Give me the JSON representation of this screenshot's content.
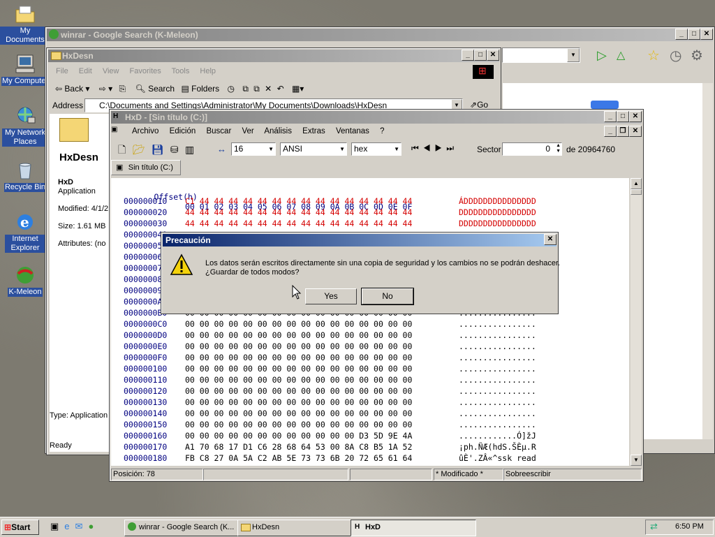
{
  "desktop": {
    "icons": [
      {
        "label": "My Documents",
        "name": "my-documents-icon"
      },
      {
        "label": "My Computer",
        "name": "my-computer-icon"
      },
      {
        "label": "My Network Places",
        "name": "my-network-places-icon"
      },
      {
        "label": "Recycle Bin",
        "name": "recycle-bin-icon"
      },
      {
        "label": "Internet Explorer",
        "name": "internet-explorer-icon"
      },
      {
        "label": "K-Meleon",
        "name": "k-meleon-icon"
      }
    ]
  },
  "browser": {
    "title": "winrar - Google Search (K-Meleon)"
  },
  "explorer": {
    "title": "HxDesn",
    "menu": [
      "File",
      "Edit",
      "View",
      "Favorites",
      "Tools",
      "Help"
    ],
    "toolbar": {
      "back": "Back",
      "search": "Search",
      "folders": "Folders"
    },
    "address_label": "Address",
    "address": "C:\\Documents and Settings\\Administrator\\My Documents\\Downloads\\HxDesn",
    "go": "Go",
    "panel": {
      "title": "HxDesn",
      "file_name": "HxD",
      "file_type": "Application",
      "modified": "Modified: 4/1/2",
      "size": "Size: 1.61 MB",
      "attributes": "Attributes: (no"
    },
    "status_type": "Type: Application",
    "status": "Ready"
  },
  "hxd": {
    "title": "HxD - [Sin título (C:)]",
    "menu": [
      "Archivo",
      "Edición",
      "Buscar",
      "Ver",
      "Análisis",
      "Extras",
      "Ventanas",
      "?"
    ],
    "bytes_per_row": "16",
    "charset": "ANSI",
    "mode": "hex",
    "sector_label": "Sector",
    "sector_value": "0",
    "sector_total": "de 20964760",
    "tab": "Sin título (C:)",
    "header_offset": "Offset(h)",
    "header_cols": "00 01 02 03 04 05 06 07 08 09 0A 0B 0C 0D 0E 0F",
    "rows": [
      {
        "off": "000000010",
        "hex": "C1 44 44 44 44 44 44 44 44 44 44 44 44 44 44 44",
        "asc": "ÁDDDDDDDDDDDDDDD",
        "red": true
      },
      {
        "off": "000000020",
        "hex": "44 44 44 44 44 44 44 44 44 44 44 44 44 44 44 44",
        "asc": "DDDDDDDDDDDDDDDD",
        "red": true
      },
      {
        "off": "000000030",
        "hex": "44 44 44 44 44 44 44 44 44 44 44 44 44 44 44 44",
        "asc": "DDDDDDDDDDDDDDDD",
        "red": true
      },
      {
        "off": "000000040",
        "hex": "",
        "asc": "",
        "red": false
      },
      {
        "off": "000000050",
        "hex": "",
        "asc": "",
        "red": false
      },
      {
        "off": "000000060",
        "hex": "",
        "asc": "",
        "red": false
      },
      {
        "off": "000000070",
        "hex": "",
        "asc": "",
        "red": false
      },
      {
        "off": "000000080",
        "hex": "",
        "asc": "",
        "red": false
      },
      {
        "off": "000000090",
        "hex": "",
        "asc": "",
        "red": false
      },
      {
        "off": "0000000A0",
        "hex": "",
        "asc": "",
        "red": false
      },
      {
        "off": "0000000B0",
        "hex": "00 00 00 00 00 00 00 00 00 00 00 00 00 00 00 00",
        "asc": "................",
        "red": false
      },
      {
        "off": "0000000C0",
        "hex": "00 00 00 00 00 00 00 00 00 00 00 00 00 00 00 00",
        "asc": "................",
        "red": false
      },
      {
        "off": "0000000D0",
        "hex": "00 00 00 00 00 00 00 00 00 00 00 00 00 00 00 00",
        "asc": "................",
        "red": false
      },
      {
        "off": "0000000E0",
        "hex": "00 00 00 00 00 00 00 00 00 00 00 00 00 00 00 00",
        "asc": "................",
        "red": false
      },
      {
        "off": "0000000F0",
        "hex": "00 00 00 00 00 00 00 00 00 00 00 00 00 00 00 00",
        "asc": "................",
        "red": false
      },
      {
        "off": "000000100",
        "hex": "00 00 00 00 00 00 00 00 00 00 00 00 00 00 00 00",
        "asc": "................",
        "red": false
      },
      {
        "off": "000000110",
        "hex": "00 00 00 00 00 00 00 00 00 00 00 00 00 00 00 00",
        "asc": "................",
        "red": false
      },
      {
        "off": "000000120",
        "hex": "00 00 00 00 00 00 00 00 00 00 00 00 00 00 00 00",
        "asc": "................",
        "red": false
      },
      {
        "off": "000000130",
        "hex": "00 00 00 00 00 00 00 00 00 00 00 00 00 00 00 00",
        "asc": "................",
        "red": false
      },
      {
        "off": "000000140",
        "hex": "00 00 00 00 00 00 00 00 00 00 00 00 00 00 00 00",
        "asc": "................",
        "red": false
      },
      {
        "off": "000000150",
        "hex": "00 00 00 00 00 00 00 00 00 00 00 00 00 00 00 00",
        "asc": "................",
        "red": false
      },
      {
        "off": "000000160",
        "hex": "00 00 00 00 00 00 00 00 00 00 00 00 D3 5D 9E 4A",
        "asc": "............Ó]žJ",
        "red": false
      },
      {
        "off": "000000170",
        "hex": "A1 70 68 17 D1 C6 28 68 64 53 00 8A C8 B5 1A 52",
        "asc": "¡ph.ÑÆ(hdS.ŠÈµ.R",
        "red": false
      },
      {
        "off": "000000180",
        "hex": "FB C8 27 0A 5A C2 AB 5E 73 73 6B 20 72 65 61 64",
        "asc": "ûÈ'.ZÂ«^ssk read",
        "red": false
      }
    ],
    "status": {
      "position": "Posición: 78",
      "modified": "* Modificado *",
      "overwrite": "Sobreescribir"
    }
  },
  "dialog": {
    "title": "Precaución",
    "line1": "Los datos serán escritos directamente sin una copia de seguridad y los cambios no se podrán deshacer.",
    "line2": "¿Guardar de todos modos?",
    "yes": "Yes",
    "no": "No"
  },
  "taskbar": {
    "start": "Start",
    "tasks": [
      "winrar - Google Search (K...",
      "HxDesn",
      "HxD"
    ],
    "clock": "6:50 PM"
  }
}
